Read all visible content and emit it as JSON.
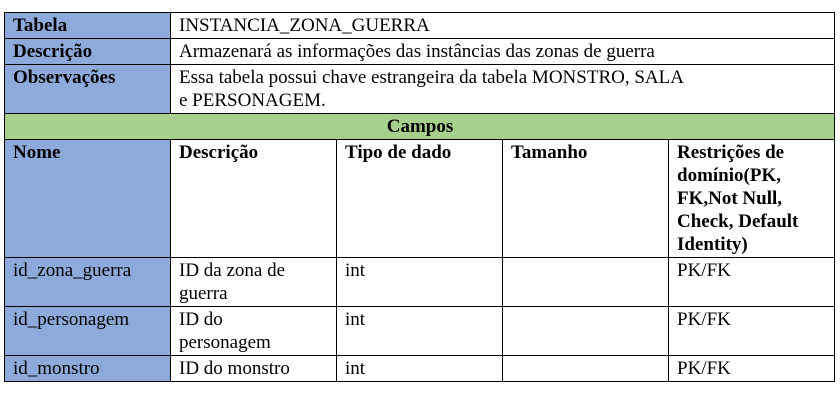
{
  "header": {
    "table_label": "Tabela",
    "table_value": "INSTANCIA_ZONA_GUERRA",
    "description_label": "Descrição",
    "description_value": "Armazenará as informações das instâncias das zonas de guerra",
    "observations_label": "Observações",
    "observations_line1": "Essa tabela possui chave estrangeira da tabela MONSTRO, SALA",
    "observations_line2": "e PERSONAGEM."
  },
  "fields_title": "Campos",
  "columns": {
    "name": "Nome",
    "description": "Descrição",
    "type": "Tipo de dado",
    "size": "Tamanho",
    "restrictions": [
      "Restrições de",
      "domínio(PK,",
      "FK,Not Null,",
      "Check, Default",
      "Identity)"
    ]
  },
  "rows": [
    {
      "name": "id_zona_guerra",
      "description": [
        "ID da zona de",
        "guerra"
      ],
      "type": "int",
      "size": "",
      "restrictions": "PK/FK"
    },
    {
      "name": "id_personagem",
      "description": [
        "ID do",
        "personagem"
      ],
      "type": "int",
      "size": "",
      "restrictions": "PK/FK"
    },
    {
      "name": "id_monstro",
      "description": [
        "ID do monstro"
      ],
      "type": "int",
      "size": "",
      "restrictions": "PK/FK"
    }
  ],
  "colors": {
    "label_blue": "#8eaadb",
    "fields_green": "#a8d08d"
  }
}
